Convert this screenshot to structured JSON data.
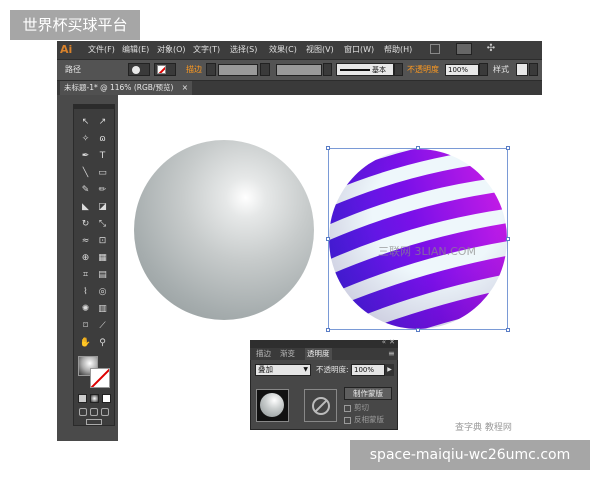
{
  "watermark_top": "世界杯买球平台",
  "watermark_bottom": "space-maiqiu-wc26umc.com",
  "watermark_small": "查字典 教程网",
  "canvas_watermark": "三联网 3LIAN.COM",
  "app": {
    "logo": "Ai",
    "menu": [
      "文件(F)",
      "编辑(E)",
      "对象(O)",
      "文字(T)",
      "选择(S)",
      "效果(C)",
      "视图(V)",
      "窗口(W)",
      "帮助(H)"
    ]
  },
  "control_bar": {
    "selection_label": "路径",
    "stroke_label": "描边",
    "stroke_style": "基本",
    "opacity_label": "不透明度",
    "opacity_value": "100%",
    "style_label": "样式"
  },
  "document_tab": {
    "title": "未标题-1* @ 116% (RGB/预览)",
    "close": "×"
  },
  "transparency_panel": {
    "tabs": [
      "描边",
      "渐变",
      "透明度"
    ],
    "active_tab_index": 2,
    "blend_mode": "叠加",
    "opacity_label": "不透明度:",
    "opacity_value": "100%",
    "make_mask_button": "制作蒙版",
    "clip_label": "剪切",
    "invert_mask_label": "反相蒙版"
  },
  "colors": {
    "accent_orange": "#ff9a1f",
    "stripe_purple": "#7a10e8",
    "stripe_magenta": "#d21ee6",
    "stripe_blue": "#3a22e0"
  }
}
